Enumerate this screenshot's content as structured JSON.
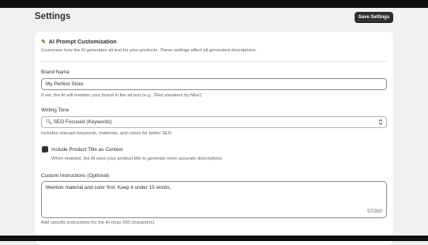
{
  "header": {
    "title": "Settings",
    "save_label": "Save Settings"
  },
  "section": {
    "emoji": "✎",
    "title": "AI Prompt Customization",
    "description": "Customize how the AI generates alt text for your products. These settings affect all generated descriptions."
  },
  "brand": {
    "label": "Brand Name",
    "value": "My Perfect Store",
    "help": "If set, the AI will mention your brand in the alt text (e.g., 'Red sneakers by Nike')"
  },
  "tone": {
    "label": "Writing Tone",
    "selected": "🔍 SEO Focused (Keywords)",
    "help": "Includes relevant keywords, materials, and colors for better SEO"
  },
  "include_title": {
    "label": "Include Product Title as Context",
    "checked": true,
    "help": "When enabled, the AI uses your product title to generate more accurate descriptions"
  },
  "instructions": {
    "label": "Custom Instructions (Optional)",
    "value": "Mention material and color first. Keep it under 15 words.",
    "count": "57/200",
    "help": "Add specific instructions for the AI (max 200 characters)"
  }
}
